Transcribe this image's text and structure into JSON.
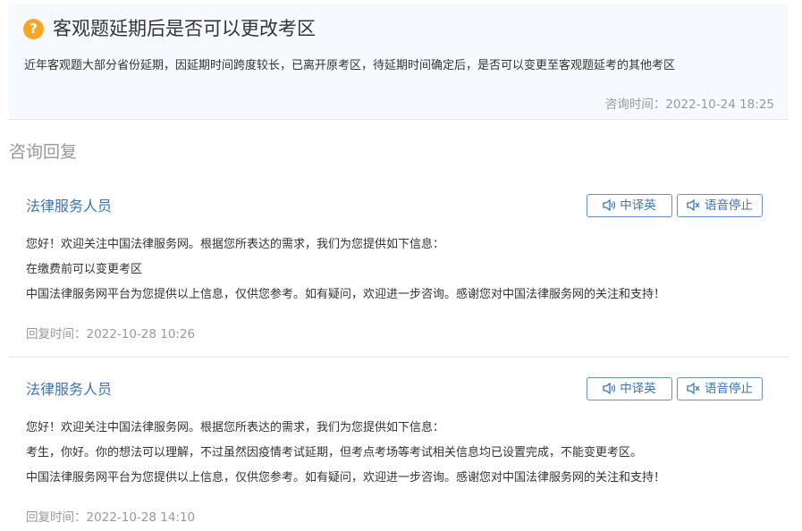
{
  "question": {
    "icon": "question-icon",
    "icon_glyph": "?",
    "title": "客观题延期后是否可以更改考区",
    "description": "近年客观题大部分省份延期，因延期时间跨度较长，已离开原考区，待延期时间确定后，是否可以变更至客观题延考的其他考区",
    "time": "咨询时间：2022-10-24 18:25"
  },
  "section_title": "咨询回复",
  "replies": [
    {
      "author": "法律服务人员",
      "translate_label": "中译英",
      "stop_label": "语音停止",
      "lines": [
        "您好！欢迎关注中国法律服务网。根据您所表达的需求，我们为您提供如下信息：",
        "在缴费前可以变更考区",
        "中国法律服务网平台为您提供以上信息，仅供您参考。如有疑问，欢迎进一步咨询。感谢您对中国法律服务网的关注和支持！"
      ],
      "time": "回复时间：2022-10-28 10:26"
    },
    {
      "author": "法律服务人员",
      "translate_label": "中译英",
      "stop_label": "语音停止",
      "lines": [
        "您好！欢迎关注中国法律服务网。根据您所表达的需求，我们为您提供如下信息：",
        "考生，你好。你的想法可以理解，不过虽然因疫情考试延期，但考点考场等考试相关信息均已设置完成，不能变更考区。",
        "中国法律服务网平台为您提供以上信息，仅供您参考。如有疑问，欢迎进一步咨询。感谢您对中国法律服务网的关注和支持！"
      ],
      "time": "回复时间：2022-10-28 14:10"
    }
  ],
  "colors": {
    "accent": "#3b74b8",
    "question_icon": "#f5a623",
    "muted_text": "#999999",
    "question_bg": "#f6fafe"
  }
}
